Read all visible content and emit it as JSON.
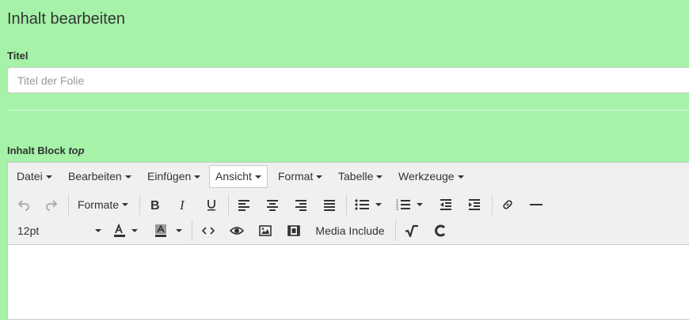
{
  "page": {
    "title": "Inhalt bearbeiten"
  },
  "title_field": {
    "label": "Titel",
    "value": "",
    "placeholder": "Titel der Folie"
  },
  "block": {
    "label_prefix": "Inhalt Block",
    "label_name": "top"
  },
  "editor": {
    "menubar": {
      "items": [
        {
          "label": "Datei"
        },
        {
          "label": "Bearbeiten"
        },
        {
          "label": "Einfügen"
        },
        {
          "label": "Ansicht",
          "active": true
        },
        {
          "label": "Format"
        },
        {
          "label": "Tabelle"
        },
        {
          "label": "Werkzeuge"
        }
      ]
    },
    "toolbar": {
      "formats_label": "Formate",
      "font_size": "12pt",
      "media_include_label": "Media Include",
      "icons": [
        "undo-icon",
        "redo-icon",
        "bold-icon",
        "italic-icon",
        "underline-icon",
        "align-left-icon",
        "align-center-icon",
        "align-right-icon",
        "align-justify-icon",
        "bullet-list-icon",
        "numbered-list-icon",
        "outdent-icon",
        "indent-icon",
        "link-icon",
        "horizontal-rule-icon",
        "text-color-icon",
        "background-color-icon",
        "code-icon",
        "preview-icon",
        "image-icon",
        "media-icon",
        "sqrt-icon",
        "c-icon"
      ]
    },
    "content": ""
  }
}
